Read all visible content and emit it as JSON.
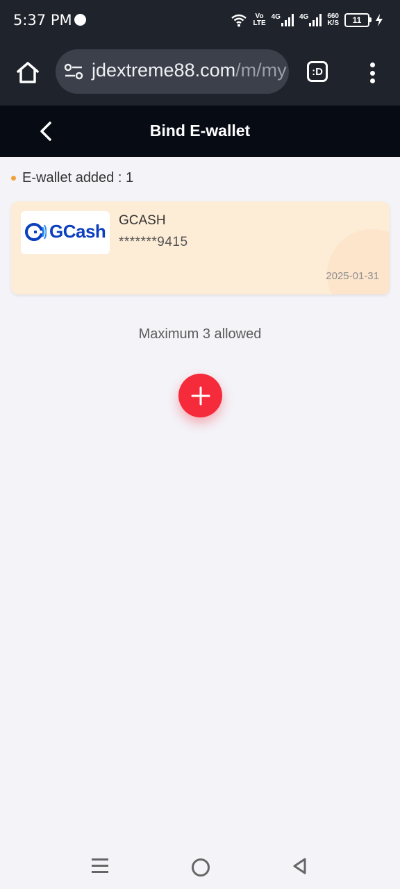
{
  "status_bar": {
    "time": "5:37 PM",
    "volte_top": "Vo",
    "volte_bottom": "LTE",
    "net1": "4G",
    "net2": "4G",
    "speed_value": "660",
    "speed_unit": "K/S",
    "battery": "11"
  },
  "browser": {
    "url_host": "jdextreme88.com",
    "url_path": "/m/my",
    "tab_label": ":D"
  },
  "header": {
    "title": "Bind E-wallet"
  },
  "summary": {
    "label": "E-wallet added : 1"
  },
  "wallet": {
    "logo_text": "GCash",
    "name": "GCASH",
    "account": "*******9415",
    "date": "2025-01-31"
  },
  "limit_text": "Maximum 3 allowed",
  "colors": {
    "accent_red": "#f52a3a",
    "card_bg": "#fdecd6",
    "gcash_blue": "#0b3fbf",
    "dot_orange": "#f0a23a"
  },
  "icons": {
    "home": "home-icon",
    "site_settings": "tune-icon",
    "tabs": "tab-switcher-icon",
    "more": "more-vertical-icon",
    "back": "chevron-left-icon",
    "add": "plus-icon"
  }
}
